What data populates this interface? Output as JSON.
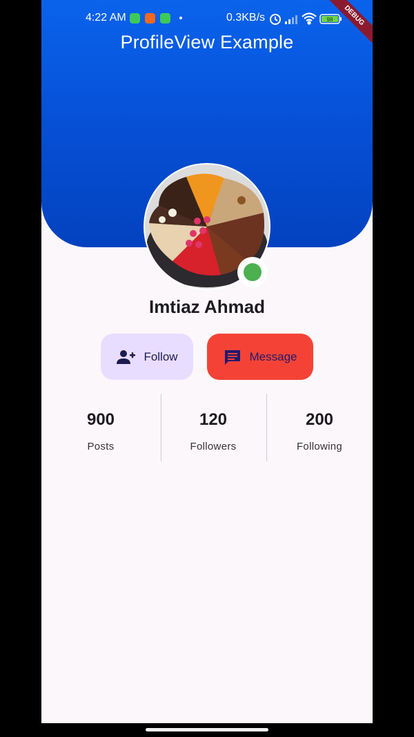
{
  "status_bar": {
    "time": "4:22 AM",
    "net_speed": "0.3KB/s",
    "battery": "98"
  },
  "app_bar": {
    "title": "ProfileView Example",
    "debug_banner": "DEBUG"
  },
  "profile": {
    "name": "Imtiaz Ahmad",
    "avatar_icon": "cake-photo",
    "online": true,
    "online_color": "#4caf50"
  },
  "actions": {
    "follow_label": "Follow",
    "follow_icon": "person-add-icon",
    "message_label": "Message",
    "message_icon": "chat-bubble-icon"
  },
  "stats": [
    {
      "value": "900",
      "label": "Posts"
    },
    {
      "value": "120",
      "label": "Followers"
    },
    {
      "value": "200",
      "label": "Following"
    }
  ],
  "colors": {
    "header": "#0650d6",
    "follow_button": "#e8ddff",
    "message_button": "#f44336",
    "background": "#fcf7fb"
  }
}
